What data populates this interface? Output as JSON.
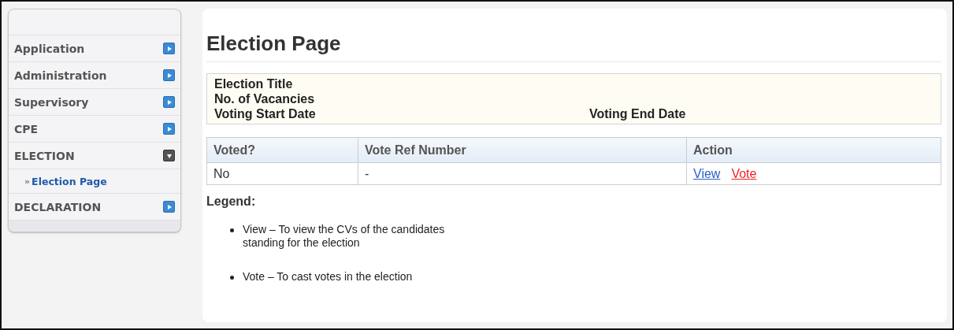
{
  "sidebar": {
    "items": [
      {
        "label": "Application",
        "expanded": false
      },
      {
        "label": "Administration",
        "expanded": false
      },
      {
        "label": "Supervisory",
        "expanded": false
      },
      {
        "label": "CPE",
        "expanded": false
      },
      {
        "label": "ELECTION",
        "expanded": true,
        "children": [
          {
            "marker": "»",
            "label": "Election Page",
            "selected": true
          }
        ]
      },
      {
        "label": "DECLARATION",
        "expanded": false
      }
    ]
  },
  "page": {
    "title": "Election Page",
    "info": {
      "election_title": "Election Title",
      "vacancies": "No. of Vacancies",
      "start_date": "Voting Start Date",
      "end_date": "Voting End Date"
    },
    "table": {
      "columns": [
        "Voted?",
        "Vote Ref Number",
        "Action"
      ],
      "rows": [
        {
          "voted": "No",
          "ref": "-",
          "actions": [
            {
              "label": "View",
              "color": "#2a5fc4"
            },
            {
              "label": "Vote",
              "color": "#ee2222"
            }
          ]
        }
      ]
    },
    "legend": {
      "title": "Legend:",
      "items": [
        "View – To view the CVs of the candidates standing for the election",
        "Vote – To cast votes in the election"
      ]
    }
  }
}
